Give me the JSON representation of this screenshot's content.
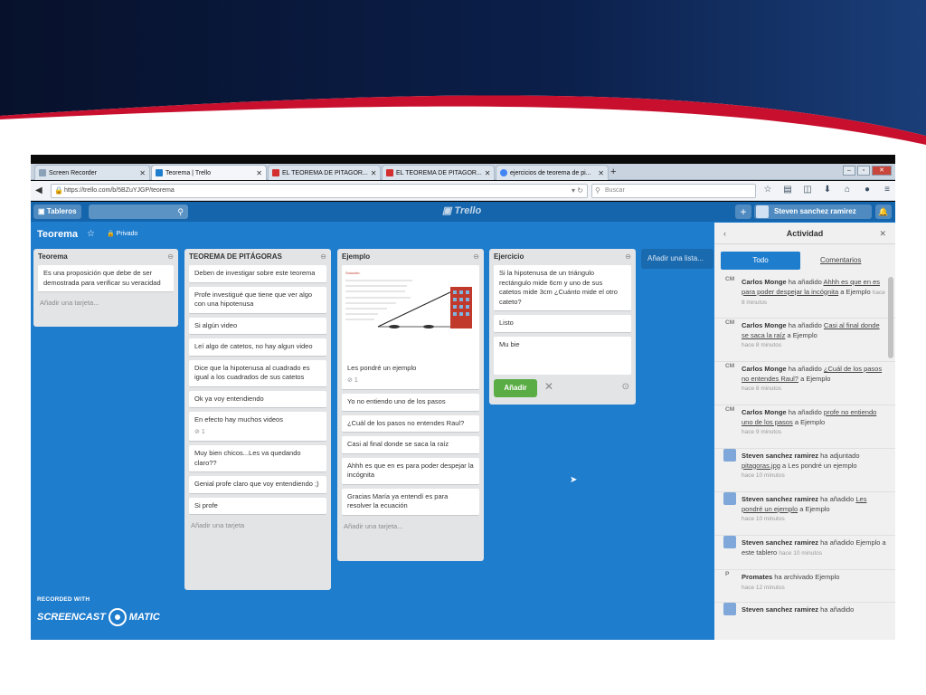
{
  "browser": {
    "tabs": [
      {
        "label": "Screen Recorder",
        "color": "#8aa1b8"
      },
      {
        "label": "Teorema | Trello",
        "color": "#1f7dce"
      },
      {
        "label": "EL TEOREMA DE PITAGOR...",
        "color": "#d32f2f"
      },
      {
        "label": "EL TEOREMA DE PITAGOR...",
        "color": "#d32f2f"
      },
      {
        "label": "ejercicios de teorema de pi...",
        "color": "#4285f4"
      }
    ],
    "new_tab": "+",
    "url": "https://trello.com/b/5BZuYJGP/teorema",
    "search_placeholder": "Buscar"
  },
  "header": {
    "boards_button": "Tableros",
    "logo": "Trello",
    "user_name": "Steven sanchez ramirez"
  },
  "board": {
    "title": "Teorema",
    "visibility": "Privado",
    "add_list": "Añadir una lista..."
  },
  "lists": [
    {
      "title": "Teorema",
      "cards": [
        "Es una proposición que debe de ser demostrada para verificar su veracidad"
      ],
      "add_card": "Añadir una tarjeta..."
    },
    {
      "title": "TEOREMA DE PITÁGORAS",
      "cards": [
        "Deben de investigar sobre este teorema",
        "Profe investigué que tiene que ver algo con una hipotenusa",
        "Si algún video",
        "Leí algo de catetos, no hay algun video",
        "Dice que la hipotenusa al cuadrado es igual a los cuadrados de sus catetos",
        "Ok ya voy entendiendo",
        "En efecto hay muchos videos",
        "Muy bien chicos...Les va quedando claro??",
        "Genial profe claro que voy entendiendo ;)",
        "Si profe"
      ],
      "card_badge": "1",
      "add_card": "Añadir una tarjeta"
    },
    {
      "title": "Ejemplo",
      "image_card": {
        "text": "Les pondré un ejemplo",
        "badge": "1",
        "image_title": "Solución:"
      },
      "cards": [
        "Yo no entiendo uno de los pasos",
        "¿Cuál de los pasos no entendes Raul?",
        "Casi al final donde se saca la raíz",
        "Ahhh es que en es para poder despejar la incógnita",
        "Gracias María ya entendí es para resolver la ecuación"
      ],
      "add_card": "Añadir una tarjeta..."
    },
    {
      "title": "Ejercicio",
      "cards": [
        "Si la hipotenusa de un triángulo rectángulo mide 6cm y uno de sus catetos mide 3cm ¿Cuánto mide el otro cateto?",
        "Listo"
      ],
      "composer_text": "Mu bie",
      "add_button": "Añadir"
    }
  ],
  "activity": {
    "title": "Actividad",
    "tab_all": "Todo",
    "tab_comments": "Comentarios",
    "items": [
      {
        "initials": "CM",
        "user": "Carlos Monge",
        "action": "ha añadido",
        "link": "Ahhh es que en es para poder despejar la incógnita",
        "suffix": "a Ejemplo",
        "time": "hace 8 minutos"
      },
      {
        "initials": "CM",
        "user": "Carlos Monge",
        "action": "ha añadido",
        "link": "Casi al final donde se saca la raíz",
        "suffix": "a Ejemplo",
        "time": "hace 8 minutos"
      },
      {
        "initials": "CM",
        "user": "Carlos Monge",
        "action": "ha añadido",
        "link": "¿Cuál de los pasos no entendes Raul?",
        "suffix": "a Ejemplo",
        "time": "hace 8 minutos"
      },
      {
        "initials": "CM",
        "user": "Carlos Monge",
        "action": "ha añadido",
        "link": "profe no entiendo uno de los pasos",
        "suffix": "a Ejemplo",
        "time": "hace 9 minutos"
      },
      {
        "initials": "",
        "user": "Steven sanchez ramirez",
        "action": "ha adjuntado",
        "link": "pitagoras.jpg",
        "suffix": "a Les pondré un ejemplo",
        "time": "hace 10 minutos"
      },
      {
        "initials": "",
        "user": "Steven sanchez ramirez",
        "action": "ha añadido",
        "link": "Les pondré un ejemplo",
        "suffix": "a Ejemplo",
        "time": "hace 10 minutos"
      },
      {
        "initials": "",
        "user": "Steven sanchez ramirez",
        "action": "ha añadido",
        "link": "",
        "suffix": "Ejemplo a este tablero",
        "time": "hace 10 minutos"
      },
      {
        "initials": "P",
        "user": "Promates",
        "action": "ha archivado Ejemplo",
        "link": "",
        "suffix": "",
        "time": "hace 12 minutos"
      },
      {
        "initials": "",
        "user": "Steven sanchez ramirez",
        "action": "ha añadido",
        "link": "",
        "suffix": "",
        "time": ""
      }
    ]
  },
  "watermark": {
    "line1": "RECORDED WITH",
    "line2a": "SCREENCAST",
    "line2b": "MATIC"
  },
  "colors": {
    "trello_blue": "#1f7dce",
    "header_blue": "#1565ad",
    "slide_navy": "#0b1a3a",
    "slide_red": "#c8102e",
    "add_green": "#5aac44"
  }
}
